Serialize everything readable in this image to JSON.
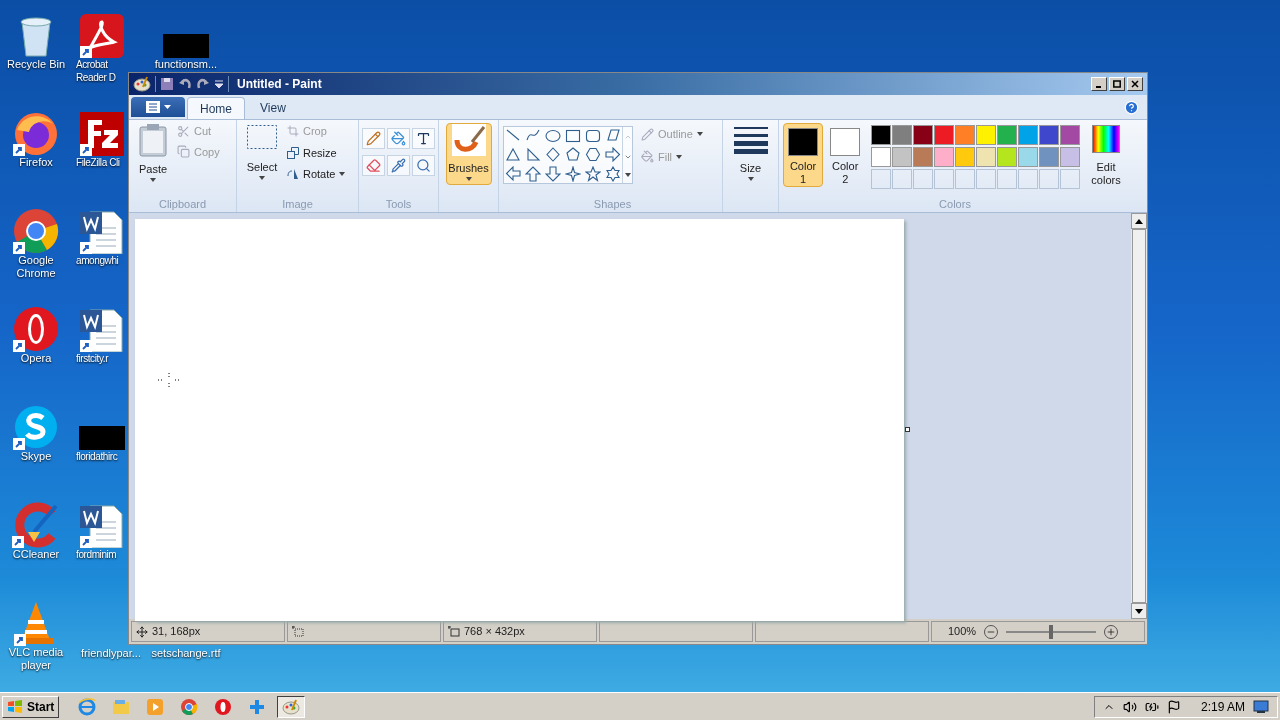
{
  "desktop": {
    "icons": [
      {
        "label": "Recycle Bin",
        "kind": "bin"
      },
      {
        "label": "Acrobat Reader D",
        "kind": "pdf"
      },
      {
        "label": "functionsm...",
        "kind": "redacted"
      },
      {
        "label": "Firefox",
        "kind": "firefox"
      },
      {
        "label": "FileZilla Cli",
        "kind": "filezilla"
      },
      {
        "label": "Google Chrome",
        "kind": "chrome"
      },
      {
        "label": "amongwhi",
        "kind": "word"
      },
      {
        "label": "Opera",
        "kind": "opera"
      },
      {
        "label": "firstcity.r",
        "kind": "word"
      },
      {
        "label": "Skype",
        "kind": "skype"
      },
      {
        "label": "floridathirc",
        "kind": "redacted"
      },
      {
        "label": "CCleaner",
        "kind": "ccleaner"
      },
      {
        "label": "fordminim",
        "kind": "word"
      },
      {
        "label": "VLC media player",
        "kind": "vlc"
      },
      {
        "label": "friendlypar...",
        "kind": "none"
      },
      {
        "label": "setschange.rtf",
        "kind": "none"
      }
    ]
  },
  "window": {
    "title": "Untitled - Paint",
    "tabs": [
      {
        "label": "Home",
        "selected": true
      },
      {
        "label": "View",
        "selected": false
      }
    ],
    "ribbon": {
      "clipboard": {
        "title": "Clipboard",
        "paste": "Paste",
        "cut": "Cut",
        "copy": "Copy"
      },
      "image": {
        "title": "Image",
        "select": "Select",
        "crop": "Crop",
        "resize": "Resize",
        "rotate": "Rotate"
      },
      "tools": {
        "title": "Tools"
      },
      "brushes": {
        "label": "Brushes",
        "selected": true
      },
      "shapes": {
        "title": "Shapes",
        "outline": "Outline",
        "fill": "Fill"
      },
      "size": {
        "label": "Size"
      },
      "colors": {
        "title": "Colors",
        "edit": "Edit colors",
        "color1": {
          "label": "Color",
          "number": "1",
          "color": "#000000",
          "selected": true
        },
        "color2": {
          "label": "Color",
          "number": "2",
          "color": "#ffffff",
          "selected": false
        },
        "palette": [
          {
            "color": "#000000"
          },
          {
            "color": "#7f7f7f"
          },
          {
            "color": "#880015"
          },
          {
            "color": "#ed1c24"
          },
          {
            "color": "#ff7f27"
          },
          {
            "color": "#fff200"
          },
          {
            "color": "#22b14c"
          },
          {
            "color": "#00a2e8"
          },
          {
            "color": "#3f48cc"
          },
          {
            "color": "#a349a4"
          },
          {
            "color": "#ffffff"
          },
          {
            "color": "#c3c3c3"
          },
          {
            "color": "#b97a57"
          },
          {
            "color": "#ffaec9"
          },
          {
            "color": "#ffc90e"
          },
          {
            "color": "#efe4b0"
          },
          {
            "color": "#b5e61d"
          },
          {
            "color": "#99d9ea"
          },
          {
            "color": "#7092be"
          },
          {
            "color": "#c8bfe7"
          }
        ]
      }
    },
    "status_bar": {
      "position": "31, 168px",
      "size": "768 × 432px",
      "zoom": "100%",
      "zoom_slider": {
        "level": 0.5
      }
    }
  },
  "taskbar": {
    "start": "Start",
    "apps": [
      {
        "kind": "ie",
        "active": false
      },
      {
        "kind": "explorer",
        "active": false
      },
      {
        "kind": "media",
        "active": false
      },
      {
        "kind": "chrome",
        "active": false
      },
      {
        "kind": "opera",
        "active": false
      },
      {
        "kind": "plus",
        "active": false
      },
      {
        "kind": "paint",
        "active": true
      }
    ],
    "clock": "2:19 AM"
  }
}
